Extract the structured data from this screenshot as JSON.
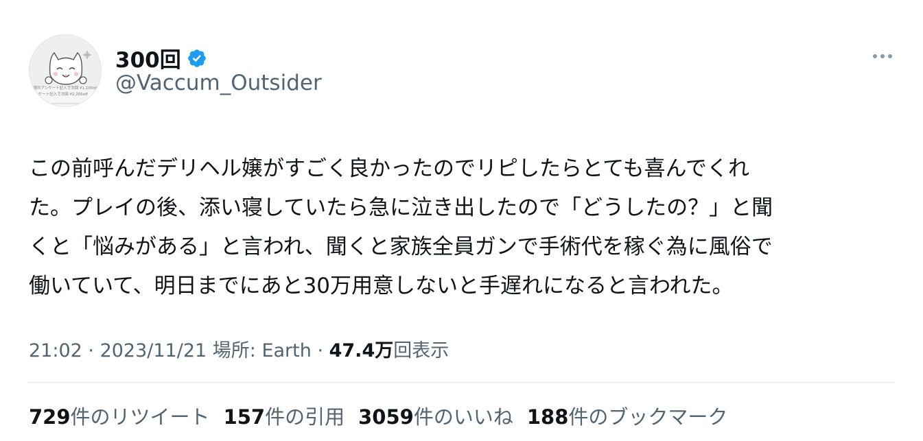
{
  "user": {
    "display_name": "300回",
    "handle": "@Vaccum_Outsider",
    "verified": true,
    "avatar_caption_lines": [
      "1週のアンケート記入で次回 ¥1,100off",
      "アンケート記入で次回 ¥2,200off"
    ]
  },
  "tweet": {
    "text": "この前呼んだデリヘル嬢がすごく良かったのでリピしたらとても喜んでくれ\nた。プレイの後、添い寝していたら急に泣き出したので「どうしたの？」と聞\nくと「悩みがある」と言われ、聞くと家族全員ガンで手術代を稼ぐ為に風俗で\n働いていて、明日までにあと30万用意しないと手遅れになると言われた。"
  },
  "meta": {
    "time": "21:02",
    "sep1": " · ",
    "date": "2023/11/21",
    "location": " 場所: Earth",
    "sep2": " · ",
    "views_count": "47.4万",
    "views_label": "回表示"
  },
  "stats": [
    {
      "count": "729",
      "label": "件のリツイート"
    },
    {
      "count": "157",
      "label": "件の引用"
    },
    {
      "count": "3059",
      "label": "件のいいね"
    },
    {
      "count": "188",
      "label": "件のブックマーク"
    }
  ],
  "icons": {
    "verified": "verified-badge-icon",
    "more": "more-horizontal-icon"
  },
  "colors": {
    "verified": "#1d9bf0",
    "secondary_text": "#536471",
    "primary_text": "#0f1419"
  }
}
